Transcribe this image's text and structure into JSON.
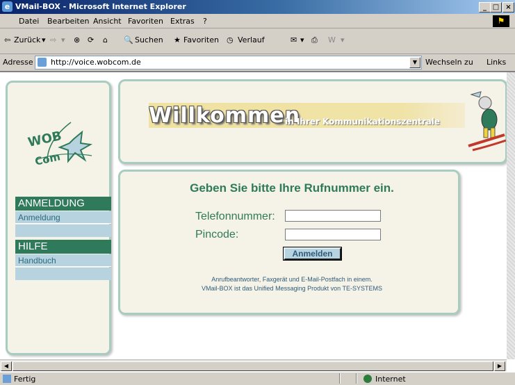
{
  "window": {
    "title": "VMail-BOX - Microsoft Internet Explorer",
    "controls": [
      "_",
      "□",
      "×"
    ]
  },
  "menu": [
    "Datei",
    "Bearbeiten",
    "Ansicht",
    "Favoriten",
    "Extras",
    "?"
  ],
  "toolbar": {
    "back": "Zurück",
    "search": "Suchen",
    "favorites": "Favoriten",
    "history": "Verlauf"
  },
  "address": {
    "label": "Adresse",
    "url": "http://voice.wobcom.de",
    "go": "Wechseln zu",
    "links": "Links"
  },
  "logo": {
    "line1": "WOB",
    "line2": "Com"
  },
  "nav": {
    "login_heading": "ANMELDUNG",
    "login_item": "Anmeldung",
    "help_heading": "HILFE",
    "help_item": "Handbuch"
  },
  "banner": {
    "welcome": "Willkommen",
    "subtitle": "in Ihrer Kommunikationszentrale"
  },
  "form": {
    "title": "Geben Sie bitte Ihre Rufnummer ein.",
    "phone_label": "Telefonnummer:",
    "phone_value": "",
    "pin_label": "Pincode:",
    "pin_value": "",
    "submit": "Anmelden",
    "footer_line1": "Anrufbeantworter, Faxgerät und E-Mail-Postfach in einem.",
    "footer_line2": "VMail-BOX ist das Unified Messaging Produkt von TE-SYSTEMS"
  },
  "status": {
    "text": "Fertig",
    "zone": "Internet"
  },
  "colors": {
    "accent_green": "#2f7a5a",
    "nav_blue": "#b7d3df",
    "panel_bg": "#f5f3e7",
    "panel_border": "#a8ccc0"
  }
}
